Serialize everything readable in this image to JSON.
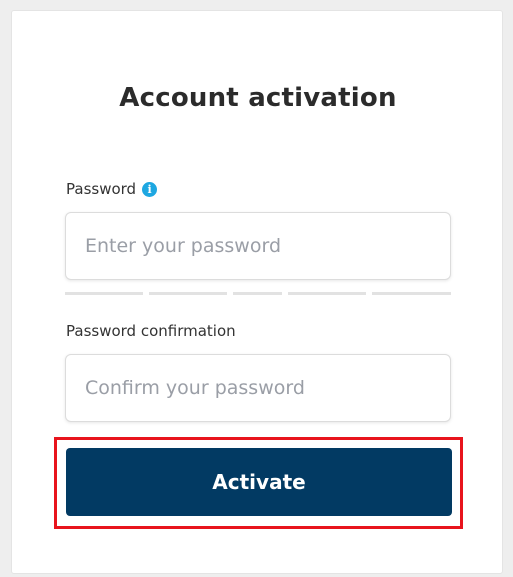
{
  "form": {
    "title": "Account activation",
    "password": {
      "label": "Password",
      "info_icon": "info-icon",
      "placeholder": "Enter your password",
      "value": ""
    },
    "confirm": {
      "label": "Password confirmation",
      "placeholder": "Confirm your password",
      "value": ""
    },
    "submit_label": "Activate"
  },
  "colors": {
    "button_bg": "#023a63",
    "info_icon": "#1ea7e1",
    "highlight_border": "#e8141d",
    "strength_empty": "#e2e2e2"
  }
}
